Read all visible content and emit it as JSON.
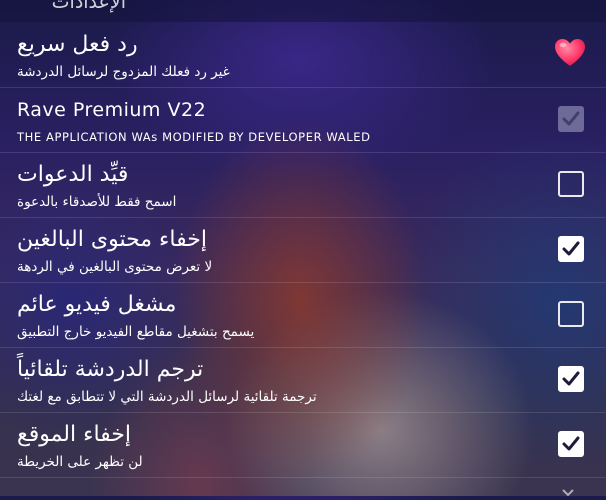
{
  "header": {
    "title": "الإعدادات"
  },
  "settings": [
    {
      "title": "رد فعل سريع",
      "subtitle": "غير رد فعلك المزدوج لرسائل الدردشة",
      "control": "heart",
      "checked": null,
      "disabled": false,
      "latin": false
    },
    {
      "title": "Rave Premium V22",
      "subtitle": "THE APPLICATION WAs MODIFIED BY DEVELOPER WALED",
      "control": "checkbox",
      "checked": true,
      "disabled": true,
      "latin": true
    },
    {
      "title": "قيِّد الدعوات",
      "subtitle": "اسمح فقط للأصدقاء بالدعوة",
      "control": "checkbox",
      "checked": false,
      "disabled": false,
      "latin": false
    },
    {
      "title": "إخفاء محتوى البالغين",
      "subtitle": "لا تعرض محتوى البالغين في الردهة",
      "control": "checkbox",
      "checked": true,
      "disabled": false,
      "latin": false
    },
    {
      "title": "مشغل فيديو عائم",
      "subtitle": "يسمح بتشغيل مقاطع الفيديو خارج التطبيق",
      "control": "checkbox",
      "checked": false,
      "disabled": false,
      "latin": false
    },
    {
      "title": "ترجم الدردشة تلقائياً",
      "subtitle": "ترجمة تلقائية لرسائل الدردشة التي لا تتطابق مع لغتك",
      "control": "checkbox",
      "checked": true,
      "disabled": false,
      "latin": false
    },
    {
      "title": "إخفاء الموقع",
      "subtitle": "لن تظهر على الخريطة",
      "control": "checkbox",
      "checked": true,
      "disabled": false,
      "latin": false
    }
  ],
  "colors": {
    "heart": "#ff3b6b",
    "checkbox_border": "#e9e9ee",
    "check_mark": "#1e1a3a"
  },
  "icons": {
    "reaction": "heart-icon",
    "check": "check-icon",
    "more": "chevron-down-icon"
  }
}
